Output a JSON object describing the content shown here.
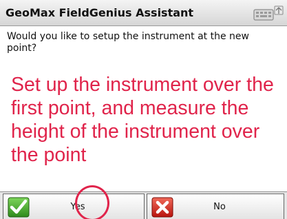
{
  "window": {
    "title": "GeoMax FieldGenius Assistant",
    "keyboard_icon": "keyboard-icon"
  },
  "dialog": {
    "question": "Would you like to setup the instrument at the new point?"
  },
  "annotation": {
    "text": "Set up the instrument over the first point, and measure the height of the instrument over the point",
    "color": "#e0244b"
  },
  "buttons": {
    "yes": {
      "label": "Yes",
      "icon": "checkmark-icon",
      "color": "#3a9a2a"
    },
    "no": {
      "label": "No",
      "icon": "x-icon",
      "color": "#d42020"
    }
  },
  "highlight": {
    "target": "yes-button",
    "color": "#e0244b"
  }
}
